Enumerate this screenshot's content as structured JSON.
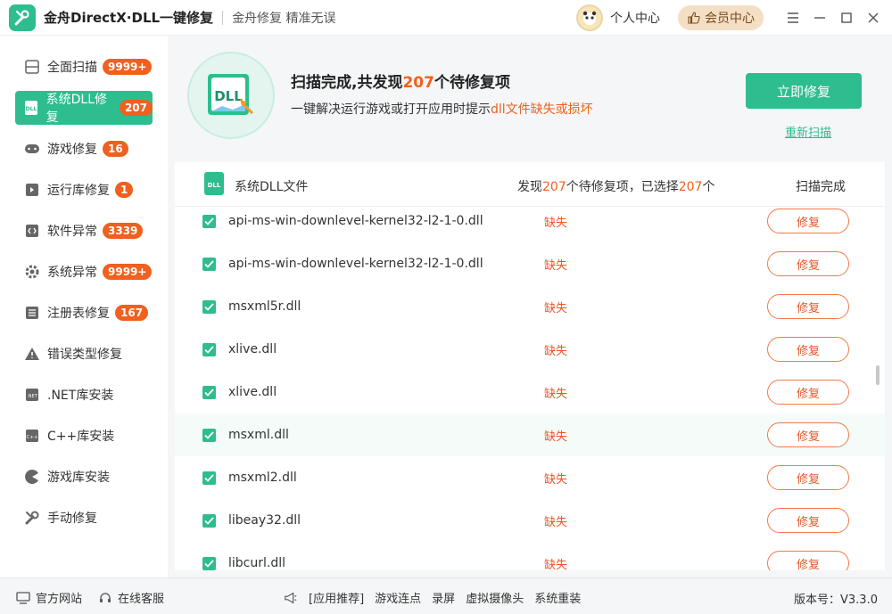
{
  "titlebar": {
    "app_title": "金舟DirectX·DLL一键修复",
    "slogan": "金舟修复 精准无误",
    "personal_center": "个人中心",
    "vip_center": "会员中心",
    "icons": [
      "menu-icon",
      "minimize-icon",
      "maximize-icon",
      "close-icon"
    ]
  },
  "sidebar": {
    "items": [
      {
        "label": "全面扫描",
        "badge": "9999+",
        "icon": "scan-icon"
      },
      {
        "label": "系统DLL修复",
        "badge": "207",
        "icon": "dll-icon",
        "active": true
      },
      {
        "label": "游戏修复",
        "badge": "16",
        "icon": "gamepad-icon"
      },
      {
        "label": "运行库修复",
        "badge": "1",
        "icon": "runtime-icon"
      },
      {
        "label": "软件异常",
        "badge": "3339",
        "icon": "code-icon"
      },
      {
        "label": "系统异常",
        "badge": "9999+",
        "icon": "gear-icon"
      },
      {
        "label": "注册表修复",
        "badge": "167",
        "icon": "list-icon"
      },
      {
        "label": "错误类型修复",
        "badge": "",
        "icon": "warning-icon"
      },
      {
        "label": ".NET库安装",
        "badge": "",
        "icon": "dotnet-icon"
      },
      {
        "label": "C++库安装",
        "badge": "",
        "icon": "cpp-icon"
      },
      {
        "label": "游戏库安装",
        "badge": "",
        "icon": "pacman-icon"
      },
      {
        "label": "手动修复",
        "badge": "",
        "icon": "wrench-icon"
      }
    ]
  },
  "banner": {
    "title_pre": "扫描完成,共发现",
    "title_num": "207",
    "title_post": "个待修复项",
    "sub_pre": "一键解决运行游戏或打开应用时提示",
    "sub_hl": "dll文件缺失或损坏",
    "fix_now": "立即修复",
    "rescan": "重新扫描",
    "dll_label": "DLL"
  },
  "list": {
    "header_title": "系统DLL文件",
    "found_pre": "发现",
    "found_num": "207",
    "found_mid": "个待修复项，已选择",
    "selected_num": "207",
    "found_post": "个",
    "status": "扫描完成",
    "rows": [
      {
        "name": "api-ms-win-downlevel-kernel32-l2-1-0.dll",
        "status": "缺失",
        "action": "修复"
      },
      {
        "name": "api-ms-win-downlevel-kernel32-l2-1-0.dll",
        "status": "缺失",
        "action": "修复"
      },
      {
        "name": "msxml5r.dll",
        "status": "缺失",
        "action": "修复"
      },
      {
        "name": "xlive.dll",
        "status": "缺失",
        "action": "修复"
      },
      {
        "name": "xlive.dll",
        "status": "缺失",
        "action": "修复"
      },
      {
        "name": "msxml.dll",
        "status": "缺失",
        "action": "修复"
      },
      {
        "name": "msxml2.dll",
        "status": "缺失",
        "action": "修复"
      },
      {
        "name": "libeay32.dll",
        "status": "缺失",
        "action": "修复"
      },
      {
        "name": "libcurl.dll",
        "status": "缺失",
        "action": "修复"
      }
    ]
  },
  "footer": {
    "website": "官方网站",
    "support": "在线客服",
    "links": [
      "[应用推荐]",
      "游戏连点",
      "录屏",
      "虚拟摄像头",
      "系统重装"
    ],
    "version": "版本号：V3.3.0"
  },
  "colors": {
    "accent": "#2dbd8f",
    "warn": "#f0601e"
  }
}
